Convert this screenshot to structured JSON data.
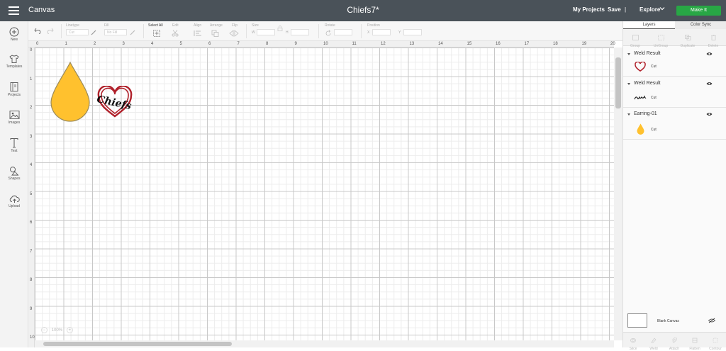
{
  "header": {
    "app_title": "Canvas",
    "project_title": "Chiefs7*",
    "my_projects": "My Projects",
    "save": "Save",
    "divider": "|",
    "explore": "Explore",
    "make_it": "Make It"
  },
  "sidebar": {
    "items": [
      {
        "label": "New",
        "icon": "plus-circle-icon"
      },
      {
        "label": "Templates",
        "icon": "shirt-icon"
      },
      {
        "label": "Projects",
        "icon": "projects-icon"
      },
      {
        "label": "Images",
        "icon": "image-icon"
      },
      {
        "label": "Text",
        "icon": "text-icon"
      },
      {
        "label": "Shapes",
        "icon": "shapes-icon"
      },
      {
        "label": "Upload",
        "icon": "upload-cloud-icon"
      }
    ]
  },
  "toolbar": {
    "linetype_label": "Linetype",
    "linetype_value": "Cut",
    "fill_label": "Fill",
    "fill_value": "No Fill",
    "select_all": "Select All",
    "edit": "Edit",
    "align": "Align",
    "arrange": "Arrange",
    "flip": "Flip",
    "size": "Size",
    "size_w": "W",
    "size_h": "H",
    "rotate": "Rotate",
    "position": "Position",
    "pos_x": "X",
    "pos_y": "Y"
  },
  "rulers": {
    "top": [
      "0",
      "1",
      "2",
      "3",
      "4",
      "5",
      "6",
      "7",
      "8",
      "9",
      "10",
      "11",
      "12",
      "13",
      "14",
      "15",
      "16",
      "17",
      "18",
      "19",
      "20"
    ],
    "left": [
      "0",
      "1",
      "2",
      "3",
      "4",
      "5",
      "6",
      "7",
      "8",
      "9",
      "10"
    ]
  },
  "canvas": {
    "zoom": "100%",
    "zoom_minus": "−",
    "zoom_plus": "+",
    "drop_color": "#FFC12E",
    "heart_color": "#B0202A",
    "logo_text": "Chiefs"
  },
  "panel": {
    "tabs": [
      "Layers",
      "Color Sync"
    ],
    "tools": [
      "Group",
      "UnGroup",
      "Duplicate",
      "Delete"
    ],
    "layers": [
      {
        "name": "Weld Result",
        "child": "Cut"
      },
      {
        "name": "Weld Result",
        "child": "Cut"
      },
      {
        "name": "Earring-01",
        "child": "Cut"
      }
    ],
    "blank_canvas": "Blank Canvas",
    "bottom_tools": [
      "Slice",
      "Weld",
      "Attach",
      "Flatten",
      "Contour"
    ]
  }
}
